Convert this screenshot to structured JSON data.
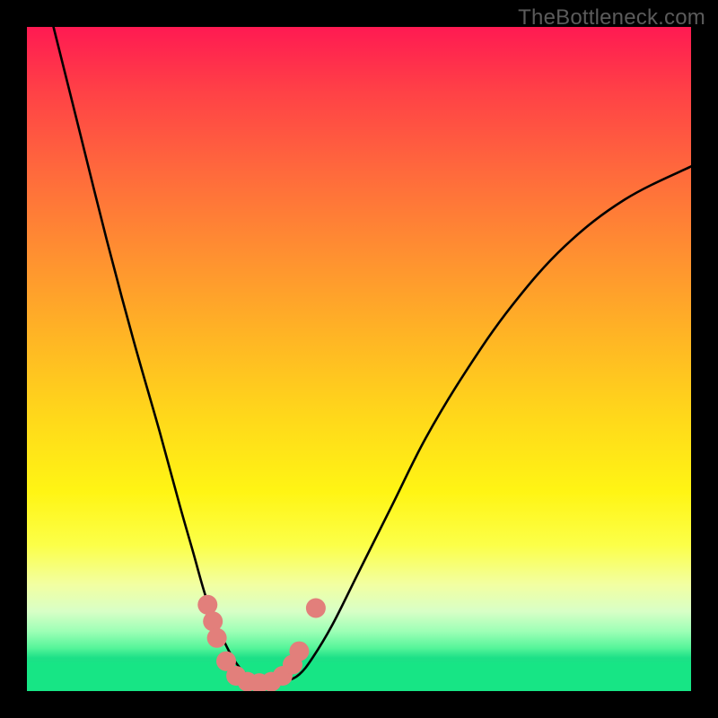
{
  "watermark": "TheBottleneck.com",
  "chart_data": {
    "type": "line",
    "title": "",
    "xlabel": "",
    "ylabel": "",
    "xlim": [
      0,
      100
    ],
    "ylim": [
      0,
      100
    ],
    "series": [
      {
        "name": "bottleneck-curve",
        "x": [
          4,
          8,
          12,
          16,
          20,
          23,
          25,
          27,
          29,
          31,
          33,
          35,
          37,
          39,
          41,
          43,
          46,
          50,
          55,
          60,
          66,
          73,
          81,
          90,
          100
        ],
        "y": [
          100,
          84,
          68,
          53,
          39,
          28,
          21,
          14,
          9,
          5,
          2.5,
          1.5,
          1.2,
          1.5,
          2.5,
          5,
          10,
          18,
          28,
          38,
          48,
          58,
          67,
          74,
          79
        ]
      }
    ],
    "markers": {
      "name": "highlight-dots",
      "color": "#e27f7b",
      "points": [
        {
          "x": 27.2,
          "y": 13.0
        },
        {
          "x": 28.0,
          "y": 10.5
        },
        {
          "x": 28.6,
          "y": 8.0
        },
        {
          "x": 30.0,
          "y": 4.5
        },
        {
          "x": 31.5,
          "y": 2.3
        },
        {
          "x": 33.2,
          "y": 1.4
        },
        {
          "x": 35.0,
          "y": 1.2
        },
        {
          "x": 36.8,
          "y": 1.4
        },
        {
          "x": 38.5,
          "y": 2.3
        },
        {
          "x": 40.0,
          "y": 4.0
        },
        {
          "x": 41.0,
          "y": 6.0
        },
        {
          "x": 43.5,
          "y": 12.5
        }
      ]
    },
    "gradient_stops": [
      {
        "pos": 0.0,
        "color": "#ff1a52"
      },
      {
        "pos": 0.58,
        "color": "#ffd61b"
      },
      {
        "pos": 0.95,
        "color": "#1de087"
      }
    ]
  }
}
